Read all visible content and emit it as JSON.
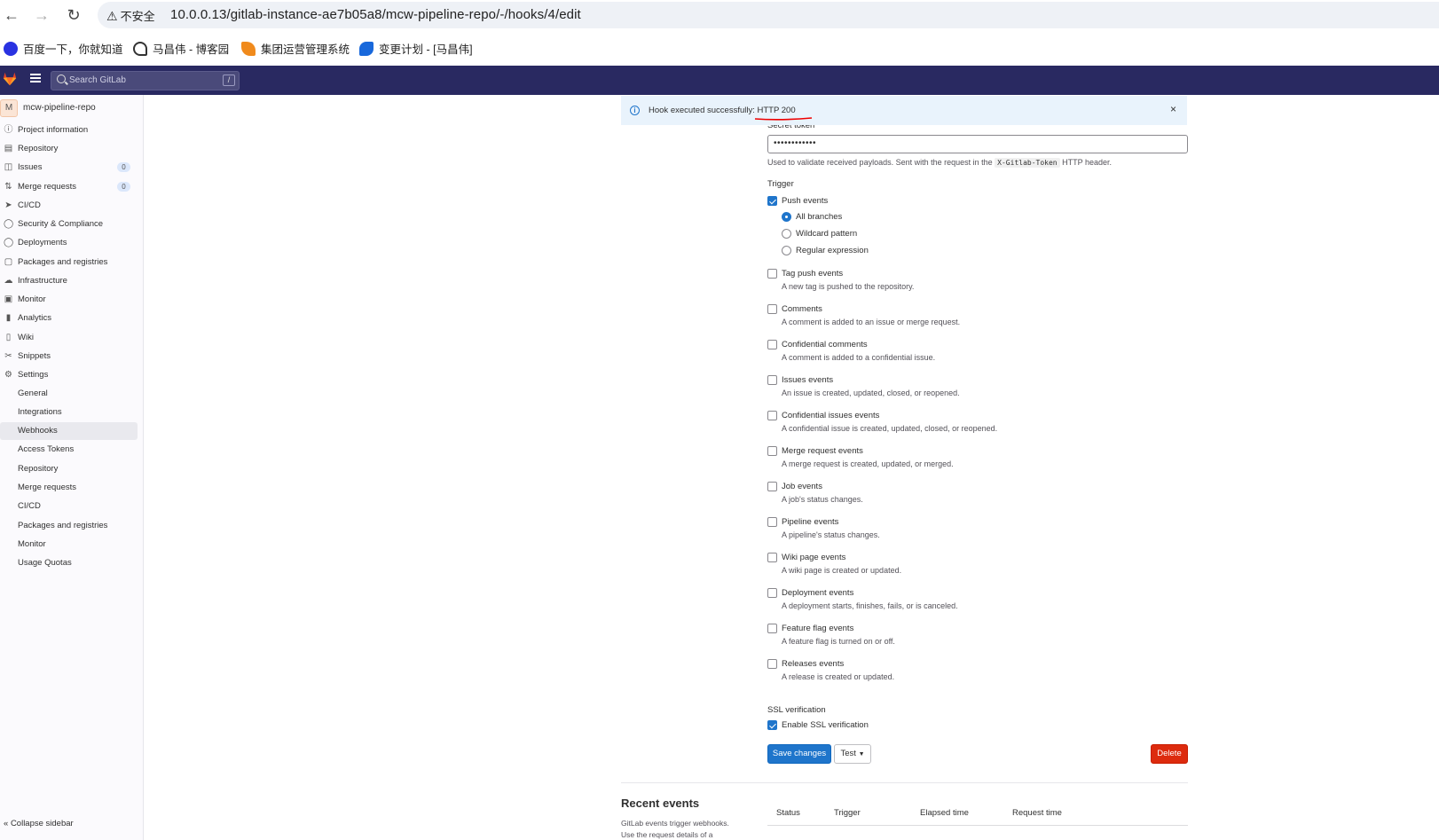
{
  "browser": {
    "security_label": "不安全",
    "url": "10.0.0.13/gitlab-instance-ae7b05a8/mcw-pipeline-repo/-/hooks/4/edit",
    "bookmarks": [
      {
        "label": "百度一下，你就知道",
        "icon": "baidu-paw-icon",
        "color": "#2932e1"
      },
      {
        "label": "马昌伟 - 博客园",
        "icon": "cnblogs-icon",
        "color": "#333333"
      },
      {
        "label": "集团运营管理系统",
        "icon": "flame-icon",
        "color": "#f08a1c"
      },
      {
        "label": "变更计划 - [马昌伟]",
        "icon": "confluence-icon",
        "color": "#1868db"
      }
    ]
  },
  "topbar": {
    "search_placeholder": "Search GitLab",
    "search_shortcut": "/",
    "bg_color": "#292961"
  },
  "sidebar": {
    "project_avatar": "M",
    "project_name": "mcw-pipeline-repo",
    "items": [
      {
        "label": "Project information",
        "icon": "info-icon"
      },
      {
        "label": "Repository",
        "icon": "doc-icon"
      },
      {
        "label": "Issues",
        "icon": "issues-icon",
        "badge": "0"
      },
      {
        "label": "Merge requests",
        "icon": "merge-icon",
        "badge": "0"
      },
      {
        "label": "CI/CD",
        "icon": "rocket-icon"
      },
      {
        "label": "Security & Compliance",
        "icon": "shield-icon"
      },
      {
        "label": "Deployments",
        "icon": "deploy-icon"
      },
      {
        "label": "Packages and registries",
        "icon": "package-icon"
      },
      {
        "label": "Infrastructure",
        "icon": "cloud-icon"
      },
      {
        "label": "Monitor",
        "icon": "monitor-icon"
      },
      {
        "label": "Analytics",
        "icon": "chart-icon"
      },
      {
        "label": "Wiki",
        "icon": "book-icon"
      },
      {
        "label": "Snippets",
        "icon": "scissors-icon"
      },
      {
        "label": "Settings",
        "icon": "gear-icon"
      }
    ],
    "settings_sub": [
      {
        "label": "General"
      },
      {
        "label": "Integrations"
      },
      {
        "label": "Webhooks",
        "active": true
      },
      {
        "label": "Access Tokens"
      },
      {
        "label": "Repository"
      },
      {
        "label": "Merge requests"
      },
      {
        "label": "CI/CD"
      },
      {
        "label": "Packages and registries"
      },
      {
        "label": "Monitor"
      },
      {
        "label": "Usage Quotas"
      }
    ],
    "collapse_label": "Collapse sidebar"
  },
  "alert": {
    "text": "Hook executed successfully: HTTP 200",
    "close": "×"
  },
  "form": {
    "secret_token_label": "Secret token",
    "secret_token_value": "••••••••••••",
    "help_pre": "Used to validate received payloads. Sent with the request in the",
    "help_code": "X-Gitlab-Token",
    "help_post": "HTTP header.",
    "trigger_title": "Trigger",
    "push_events_label": "Push events",
    "push_events_checked": true,
    "branch_options": [
      {
        "label": "All branches",
        "checked": true
      },
      {
        "label": "Wildcard pattern",
        "checked": false
      },
      {
        "label": "Regular expression",
        "checked": false
      }
    ],
    "events": [
      {
        "label": "Tag push events",
        "desc": "A new tag is pushed to the repository.",
        "checked": false
      },
      {
        "label": "Comments",
        "desc": "A comment is added to an issue or merge request.",
        "checked": false
      },
      {
        "label": "Confidential comments",
        "desc": "A comment is added to a confidential issue.",
        "checked": false
      },
      {
        "label": "Issues events",
        "desc": "An issue is created, updated, closed, or reopened.",
        "checked": false
      },
      {
        "label": "Confidential issues events",
        "desc": "A confidential issue is created, updated, closed, or reopened.",
        "checked": false
      },
      {
        "label": "Merge request events",
        "desc": "A merge request is created, updated, or merged.",
        "checked": false
      },
      {
        "label": "Job events",
        "desc": "A job's status changes.",
        "checked": false
      },
      {
        "label": "Pipeline events",
        "desc": "A pipeline's status changes.",
        "checked": false
      },
      {
        "label": "Wiki page events",
        "desc": "A wiki page is created or updated.",
        "checked": false
      },
      {
        "label": "Deployment events",
        "desc": "A deployment starts, finishes, fails, or is canceled.",
        "checked": false
      },
      {
        "label": "Feature flag events",
        "desc": "A feature flag is turned on or off.",
        "checked": false
      },
      {
        "label": "Releases events",
        "desc": "A release is created or updated.",
        "checked": false
      }
    ],
    "ssl_title": "SSL verification",
    "ssl_label": "Enable SSL verification",
    "ssl_checked": true,
    "save_label": "Save changes",
    "test_label": "Test",
    "delete_label": "Delete"
  },
  "recent_events": {
    "title": "Recent events",
    "desc": "GitLab events trigger webhooks. Use the request details of a",
    "columns": [
      "Status",
      "Trigger",
      "Elapsed time",
      "Request time"
    ]
  }
}
